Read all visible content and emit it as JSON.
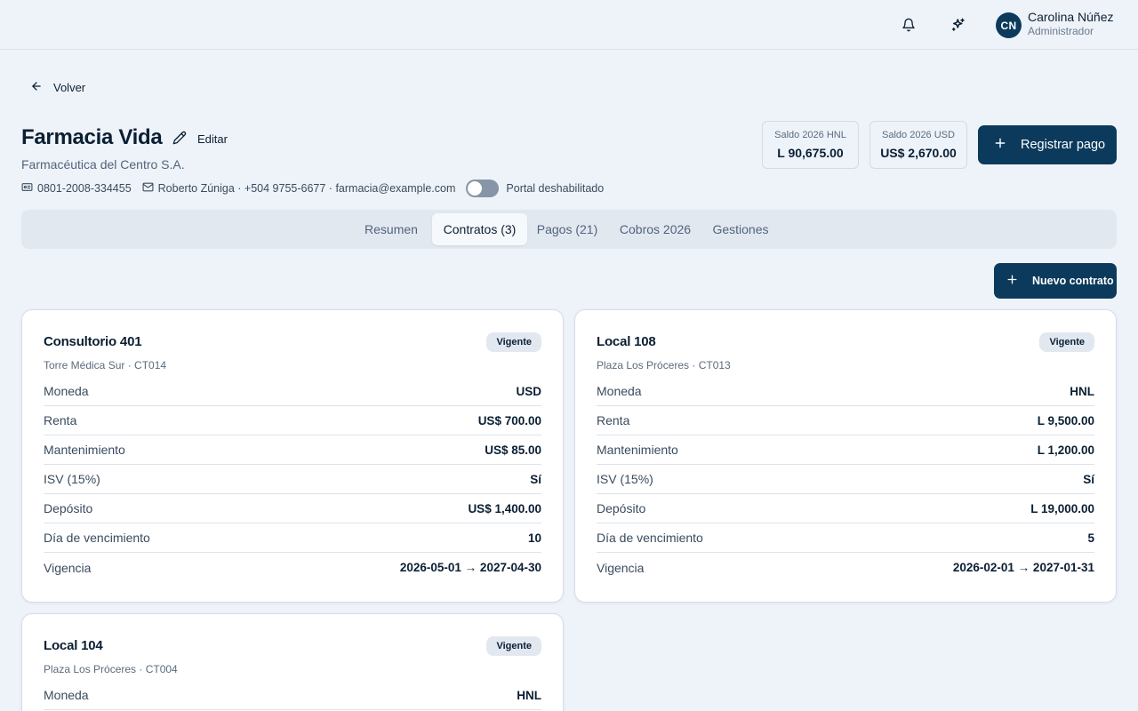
{
  "user": {
    "initials": "CN",
    "name": "Carolina Núñez",
    "role": "Administrador"
  },
  "nav": {
    "back_label": "Volver"
  },
  "tenant": {
    "name": "Farmacia Vida",
    "edit_label": "Editar",
    "company": "Farmacéutica del Centro S.A.",
    "rtn": "0801-2008-334455",
    "contact": "Roberto Zúniga · +504 9755-6677 · farmacia@example.com",
    "portal_status": "Portal deshabilitado"
  },
  "balances": [
    {
      "label": "Saldo 2026 HNL",
      "value": "L 90,675.00"
    },
    {
      "label": "Saldo 2026 USD",
      "value": "US$ 2,670.00"
    }
  ],
  "actions": {
    "register_payment": "Registrar pago",
    "new_contract": "Nuevo contrato"
  },
  "tabs": [
    {
      "label": "Resumen",
      "active": false
    },
    {
      "label": "Contratos (3)",
      "active": true
    },
    {
      "label": "Pagos (21)",
      "active": false
    },
    {
      "label": "Cobros 2026",
      "active": false
    },
    {
      "label": "Gestiones",
      "active": false
    }
  ],
  "contracts": [
    {
      "title": "Consultorio 401",
      "status": "Vigente",
      "subtitle": "Torre Médica Sur · CT014",
      "rows": [
        {
          "k": "Moneda",
          "v": "USD"
        },
        {
          "k": "Renta",
          "v": "US$ 700.00"
        },
        {
          "k": "Mantenimiento",
          "v": "US$ 85.00"
        },
        {
          "k": "ISV (15%)",
          "v": "Sí"
        },
        {
          "k": "Depósito",
          "v": "US$ 1,400.00"
        },
        {
          "k": "Día de vencimiento",
          "v": "10"
        },
        {
          "k": "Vigencia",
          "v": "2026-05-01 → 2027-04-30"
        }
      ]
    },
    {
      "title": "Local 108",
      "status": "Vigente",
      "subtitle": "Plaza Los Próceres · CT013",
      "rows": [
        {
          "k": "Moneda",
          "v": "HNL"
        },
        {
          "k": "Renta",
          "v": "L 9,500.00"
        },
        {
          "k": "Mantenimiento",
          "v": "L 1,200.00"
        },
        {
          "k": "ISV (15%)",
          "v": "Sí"
        },
        {
          "k": "Depósito",
          "v": "L 19,000.00"
        },
        {
          "k": "Día de vencimiento",
          "v": "5"
        },
        {
          "k": "Vigencia",
          "v": "2026-02-01 → 2027-01-31"
        }
      ]
    },
    {
      "title": "Local 104",
      "status": "Vigente",
      "subtitle": "Plaza Los Próceres · CT004",
      "rows": [
        {
          "k": "Moneda",
          "v": "HNL"
        }
      ]
    }
  ]
}
